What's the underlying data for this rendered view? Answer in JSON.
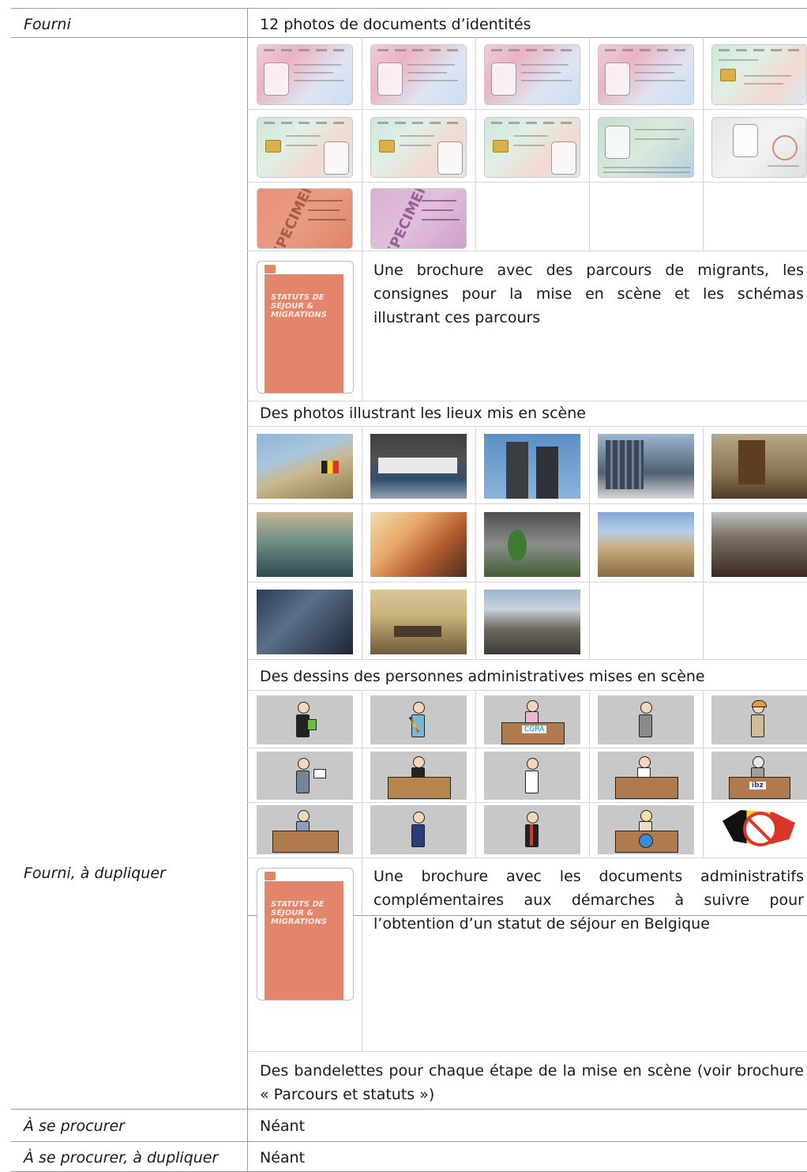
{
  "rows": [
    {
      "label": "Fourni",
      "content": "12 photos de documents d’identités"
    },
    {
      "label": "",
      "content": "Une brochure avec des parcours de migrants, les consignes pour la mise en scène et les schémas illustrant ces parcours"
    },
    {
      "label": "",
      "content": "Des photos illustrant les lieux mis en scène"
    },
    {
      "label": "",
      "content": "Des dessins des personnes administratives mises en scène"
    },
    {
      "label": "Fourni, à dupliquer",
      "content": "Une brochure avec les documents administratifs complémentaires aux démarches à suivre pour l’obtention d’un statut de séjour en Belgique"
    },
    {
      "label": "",
      "content": "Des bandelettes pour chaque étape de la mise en scène (voir brochure « Parcours et statuts »)"
    },
    {
      "label": "À se procurer",
      "content": "Néant"
    },
    {
      "label": "À se procurer, à dupliquer",
      "content": "Néant"
    }
  ],
  "brochure_cover": {
    "title": "STATUTS DE SÉJOUR & MIGRATIONS"
  },
  "specimen_stamp": "SPECIMEN",
  "logos": {
    "cgra": "CGRA",
    "ibz": "ibz"
  }
}
